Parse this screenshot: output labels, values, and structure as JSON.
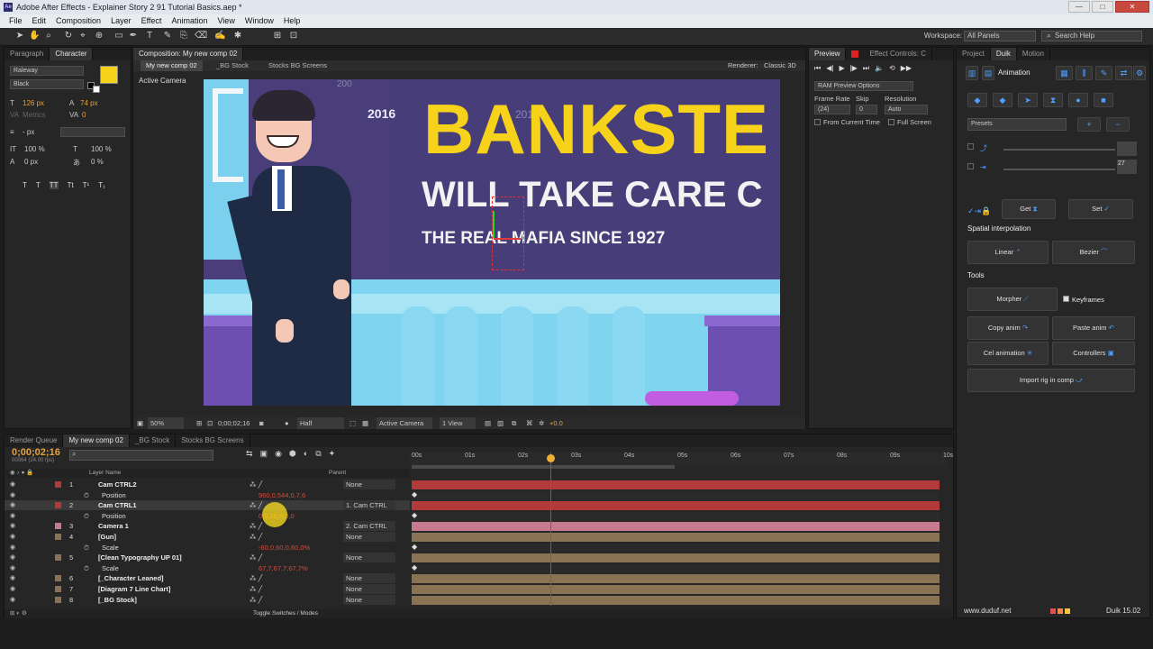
{
  "window": {
    "title": "Adobe After Effects - Explainer Story 2 91 Tutorial Basics.aep *",
    "minimize": "—",
    "maximize": "□",
    "close": "✕"
  },
  "menu": [
    "File",
    "Edit",
    "Composition",
    "Layer",
    "Effect",
    "Animation",
    "View",
    "Window",
    "Help"
  ],
  "toolbar": {
    "workspace_label": "Workspace:",
    "workspace_value": "All Panels",
    "search_placeholder": "Search Help"
  },
  "char_panel": {
    "tabs": [
      "Paragraph",
      "Character"
    ],
    "font": "Raleway",
    "style": "Black",
    "size": "126 px",
    "leading": "74 px",
    "kerning": "Metrics",
    "tracking": "0",
    "stroke": "- px",
    "vscale": "100 %",
    "hscale": "100 %",
    "baseline": "0 px",
    "tsume": "0 %",
    "styles": [
      "T",
      "T",
      "TT",
      "Tt",
      "T¹",
      "T₁"
    ]
  },
  "comp_panel": {
    "tab": "Composition: My new comp 02",
    "flow": [
      "My new comp 02",
      "_BG Stock",
      "Stocks BG Screens"
    ],
    "renderer_label": "Renderer:",
    "renderer_value": "Classic 3D",
    "camera_label": "Active Camera",
    "artwork": {
      "year_left": "2016",
      "year_top": "200",
      "year_mid": "201",
      "headline": "BANKSTE",
      "subhead": "WILL TAKE CARE C",
      "tagline": "THE REAL MAFIA SINCE 1927"
    },
    "footer": {
      "zoom": "50%",
      "timecode": "0;00;02;16",
      "resolution": "Half",
      "view": "Active Camera",
      "views": "1 View",
      "exposure": "+0.0"
    }
  },
  "preview_panel": {
    "tabs": [
      "Preview",
      "Effect Controls: C"
    ],
    "transport": [
      "⏮",
      "◀|",
      "▶",
      "|▶",
      "⏭",
      "🔈",
      "⟲",
      "▶▶"
    ],
    "ram_preview": "RAM Preview Options",
    "frame_rate_label": "Frame Rate",
    "skip_label": "Skip",
    "resolution_label": "Resolution",
    "frame_rate": "(24)",
    "skip": "0",
    "resolution": "Auto",
    "from_current": "From Current Time",
    "full_screen": "Full Screen"
  },
  "duik_panel": {
    "tabs": [
      "Project",
      "Duik",
      "Motion"
    ],
    "section": "Animation",
    "presets": "Presets",
    "value_box": "27",
    "get": "Get",
    "set": "Set",
    "spatial": "Spatial interpolation",
    "linear": "Linear",
    "bezier": "Bezier",
    "tools": "Tools",
    "morpher": "Morpher",
    "keyframes": "Keyframes",
    "copy_anim": "Copy anim",
    "paste_anim": "Paste anim",
    "cel_animation": "Cel animation",
    "controllers": "Controllers",
    "import_rig": "Import rig in comp",
    "website": "www.duduf.net",
    "version": "Duik 15.02"
  },
  "timeline": {
    "tabs": [
      "Render Queue",
      "My new comp 02",
      "_BG Stock",
      "Stocks BG Screens"
    ],
    "timecode": "0;00;02;16",
    "frames": "00064 (24.00 fps)",
    "col_layer_name": "Layer Name",
    "col_parent": "Parent",
    "ruler": [
      "00s",
      "01s",
      "02s",
      "03s",
      "04s",
      "05s",
      "06s",
      "07s",
      "08s",
      "09s",
      "10s"
    ],
    "footer": "Toggle Switches / Modes",
    "layers": [
      {
        "num": "1",
        "name": "Cam CTRL2",
        "parent": "None",
        "value": "",
        "color": "#b33a3a"
      },
      {
        "num": "",
        "name": "Position",
        "parent": "",
        "value": "960,0,544,0,7,6",
        "color": ""
      },
      {
        "num": "2",
        "name": "Cam CTRL1",
        "parent": "1. Cam CTRL",
        "value": "",
        "color": "#b33a3a"
      },
      {
        "num": "",
        "name": "Position",
        "parent": "",
        "value": "0,0,25,0,0,0",
        "color": ""
      },
      {
        "num": "3",
        "name": "Camera 1",
        "parent": "2. Cam CTRL",
        "value": "",
        "color": "#c77a8f"
      },
      {
        "num": "4",
        "name": "[Gun]",
        "parent": "None",
        "value": "",
        "color": "#8a7355"
      },
      {
        "num": "",
        "name": "Scale",
        "parent": "",
        "value": "-60,0,60,0,60,0%",
        "color": ""
      },
      {
        "num": "5",
        "name": "[Clean Typography UP 01]",
        "parent": "None",
        "value": "",
        "color": "#8a7355"
      },
      {
        "num": "",
        "name": "Scale",
        "parent": "",
        "value": "67,7,67,7,67,7%",
        "color": ""
      },
      {
        "num": "6",
        "name": "[_Character Leaned]",
        "parent": "None",
        "value": "",
        "color": "#8a7355"
      },
      {
        "num": "7",
        "name": "[Diagram 7 Line Chart]",
        "parent": "None",
        "value": "",
        "color": "#8a7355"
      },
      {
        "num": "8",
        "name": "[_BG Stock]",
        "parent": "None",
        "value": "",
        "color": "#8a7355"
      }
    ]
  }
}
